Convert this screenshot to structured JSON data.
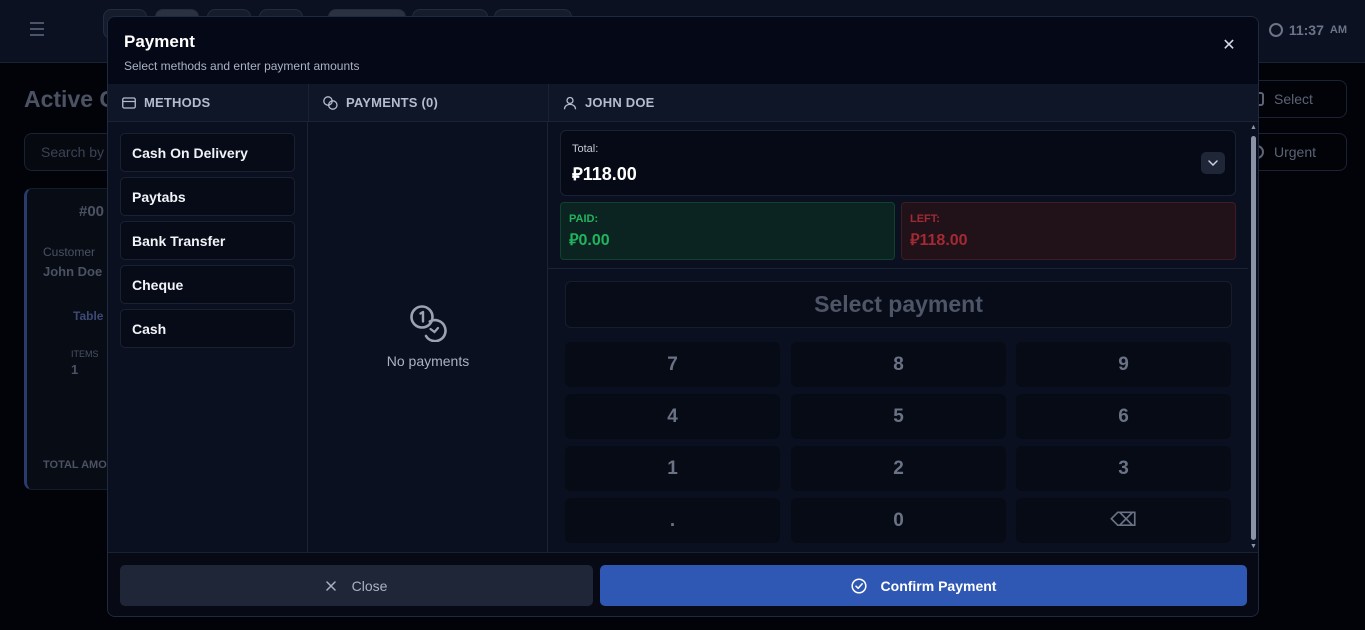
{
  "background": {
    "page_title": "Active C",
    "search_placeholder": "Search by",
    "clock_time": "11:37",
    "clock_ampm": "AM",
    "select_label": "Select",
    "urgent_label": "Urgent",
    "card": {
      "order_number": "#00",
      "customer_label": "Customer",
      "customer_name": "John Doe",
      "table_label": "Table",
      "items_label": "ITEMS",
      "items_count": "1",
      "total_label": "TOTAL AMO"
    }
  },
  "modal": {
    "title": "Payment",
    "subtitle": "Select methods and enter payment amounts",
    "close_glyph": "✕"
  },
  "methods": {
    "header": "METHODS",
    "items": [
      "Cash On Delivery",
      "Paytabs",
      "Bank Transfer",
      "Cheque",
      "Cash"
    ]
  },
  "payments": {
    "header": "PAYMENTS (0)",
    "empty_text": "No payments"
  },
  "customer": {
    "header": "JOHN DOE",
    "total_label": "Total:",
    "total_value": "⃁118.00",
    "paid_label": "PAID:",
    "paid_value": "⃁0.00",
    "left_label": "LEFT:",
    "left_value": "⃁118.00"
  },
  "keypad": {
    "display": "Select payment",
    "keys": [
      "7",
      "8",
      "9",
      "4",
      "5",
      "6",
      "1",
      "2",
      "3",
      ".",
      "0",
      "⌫"
    ]
  },
  "footer": {
    "close_label": "Close",
    "confirm_label": "Confirm Payment"
  },
  "colors": {
    "confirm_button": "#2f57b4",
    "paid": "#22b35e",
    "left": "#a32a33"
  }
}
